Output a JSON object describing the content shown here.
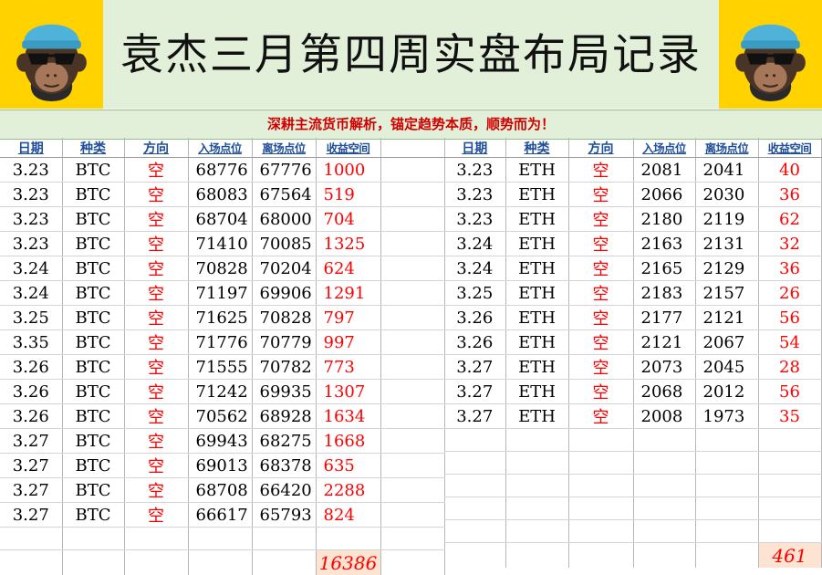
{
  "title": "袁杰三月第四周实盘布局记录",
  "subtitle": "深耕主流货币解析，锚定趋势本质，顺势而为！",
  "columns": [
    "日期",
    "种类",
    "方向",
    "入场点位",
    "离场点位",
    "收益空间"
  ],
  "btc": {
    "rows": [
      {
        "date": "3.23",
        "symbol": "BTC",
        "side": "空",
        "entry": "68776",
        "exit": "67776",
        "profit": "1000"
      },
      {
        "date": "3.23",
        "symbol": "BTC",
        "side": "空",
        "entry": "68083",
        "exit": "67564",
        "profit": "519"
      },
      {
        "date": "3.23",
        "symbol": "BTC",
        "side": "空",
        "entry": "68704",
        "exit": "68000",
        "profit": "704"
      },
      {
        "date": "3.23",
        "symbol": "BTC",
        "side": "空",
        "entry": "71410",
        "exit": "70085",
        "profit": "1325"
      },
      {
        "date": "3.24",
        "symbol": "BTC",
        "side": "空",
        "entry": "70828",
        "exit": "70204",
        "profit": "624"
      },
      {
        "date": "3.24",
        "symbol": "BTC",
        "side": "空",
        "entry": "71197",
        "exit": "69906",
        "profit": "1291"
      },
      {
        "date": "3.25",
        "symbol": "BTC",
        "side": "空",
        "entry": "71625",
        "exit": "70828",
        "profit": "797"
      },
      {
        "date": "3.35",
        "symbol": "BTC",
        "side": "空",
        "entry": "71776",
        "exit": "70779",
        "profit": "997"
      },
      {
        "date": "3.26",
        "symbol": "BTC",
        "side": "空",
        "entry": "71555",
        "exit": "70782",
        "profit": "773"
      },
      {
        "date": "3.26",
        "symbol": "BTC",
        "side": "空",
        "entry": "71242",
        "exit": "69935",
        "profit": "1307"
      },
      {
        "date": "3.26",
        "symbol": "BTC",
        "side": "空",
        "entry": "70562",
        "exit": "68928",
        "profit": "1634"
      },
      {
        "date": "3.27",
        "symbol": "BTC",
        "side": "空",
        "entry": "69943",
        "exit": "68275",
        "profit": "1668"
      },
      {
        "date": "3.27",
        "symbol": "BTC",
        "side": "空",
        "entry": "69013",
        "exit": "68378",
        "profit": "635"
      },
      {
        "date": "3.27",
        "symbol": "BTC",
        "side": "空",
        "entry": "68708",
        "exit": "66420",
        "profit": "2288"
      },
      {
        "date": "3.27",
        "symbol": "BTC",
        "side": "空",
        "entry": "66617",
        "exit": "65793",
        "profit": "824"
      }
    ],
    "total": "16386"
  },
  "eth": {
    "rows": [
      {
        "date": "3.23",
        "symbol": "ETH",
        "side": "空",
        "entry": "2081",
        "exit": "2041",
        "profit": "40"
      },
      {
        "date": "3.23",
        "symbol": "ETH",
        "side": "空",
        "entry": "2066",
        "exit": "2030",
        "profit": "36"
      },
      {
        "date": "3.23",
        "symbol": "ETH",
        "side": "空",
        "entry": "2180",
        "exit": "2119",
        "profit": "62"
      },
      {
        "date": "3.24",
        "symbol": "ETH",
        "side": "空",
        "entry": "2163",
        "exit": "2131",
        "profit": "32"
      },
      {
        "date": "3.24",
        "symbol": "ETH",
        "side": "空",
        "entry": "2165",
        "exit": "2129",
        "profit": "36"
      },
      {
        "date": "3.25",
        "symbol": "ETH",
        "side": "空",
        "entry": "2183",
        "exit": "2157",
        "profit": "26"
      },
      {
        "date": "3.26",
        "symbol": "ETH",
        "side": "空",
        "entry": "2177",
        "exit": "2121",
        "profit": "56"
      },
      {
        "date": "3.26",
        "symbol": "ETH",
        "side": "空",
        "entry": "2121",
        "exit": "2067",
        "profit": "54"
      },
      {
        "date": "3.27",
        "symbol": "ETH",
        "side": "空",
        "entry": "2073",
        "exit": "2045",
        "profit": "28"
      },
      {
        "date": "3.27",
        "symbol": "ETH",
        "side": "空",
        "entry": "2068",
        "exit": "2012",
        "profit": "56"
      },
      {
        "date": "3.27",
        "symbol": "ETH",
        "side": "空",
        "entry": "2008",
        "exit": "1973",
        "profit": "35"
      }
    ],
    "total": "461"
  },
  "logo": {
    "icon": "monkey-sunglasses-icon",
    "background": "#ffd200",
    "beanie": "#4fb3d9"
  },
  "colors": {
    "header_bg": "#e2f0d9",
    "accent_red": "#ff0000",
    "header_text_blue": "#1f4e9a",
    "total_bg": "#fde3d2"
  }
}
